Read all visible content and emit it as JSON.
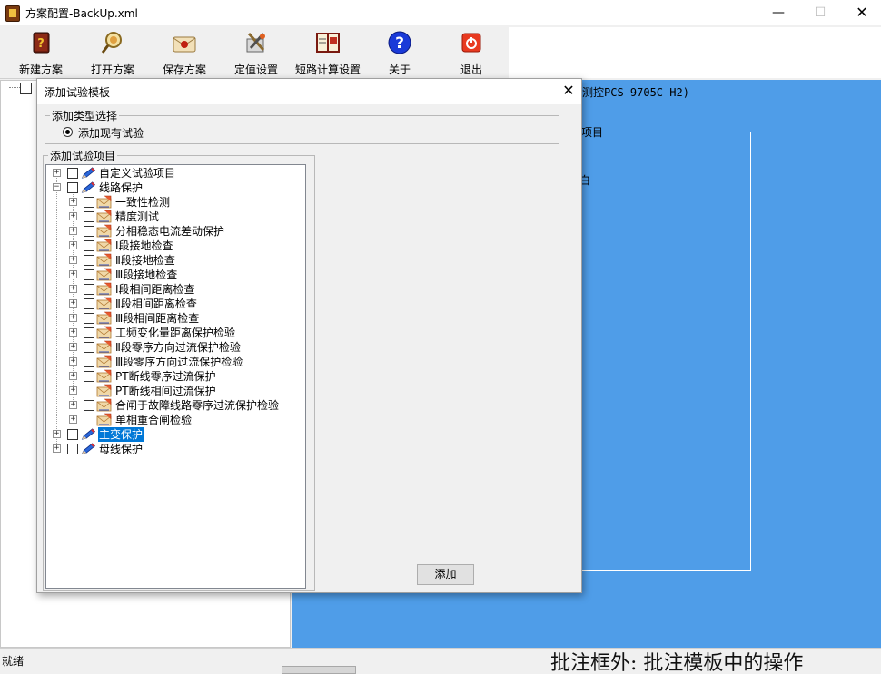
{
  "window": {
    "title": "方案配置-BackUp.xml",
    "min_glyph": "—",
    "max_glyph": "☐",
    "close_glyph": "✕"
  },
  "toolbar": [
    {
      "label": "新建方案",
      "icon": "new-scheme-book-icon"
    },
    {
      "label": "打开方案",
      "icon": "open-scheme-magnifier-icon"
    },
    {
      "label": "保存方案",
      "icon": "save-scheme-envelope-icon"
    },
    {
      "label": "定值设置",
      "icon": "setting-values-tools-icon"
    },
    {
      "label": "短路计算设置",
      "icon": "short-circuit-calc-book-icon"
    },
    {
      "label": "关于",
      "icon": "help-question-icon"
    },
    {
      "label": "退出",
      "icon": "exit-power-icon"
    }
  ],
  "right_panel": {
    "header": "测控PCS-9705C-H2)",
    "group_label": "的项目",
    "fragment": "白"
  },
  "dialog": {
    "title": "添加试验模板",
    "close_glyph": "✕",
    "type_group_label": "添加类型选择",
    "radio_label": "添加现有试验",
    "items_group_label": "添加试验项目",
    "add_button": "添加"
  },
  "tree": [
    {
      "label": "自定义试验项目",
      "level": 0,
      "expander": "+",
      "icon": "pencil-icon",
      "selected": false
    },
    {
      "label": "线路保护",
      "level": 0,
      "expander": "−",
      "icon": "pencil-icon",
      "selected": false
    },
    {
      "label": "一致性检测",
      "level": 1,
      "expander": "+",
      "icon": "test-item-icon",
      "selected": false
    },
    {
      "label": "精度测试",
      "level": 1,
      "expander": "+",
      "icon": "test-item-icon",
      "selected": false
    },
    {
      "label": "分相稳态电流差动保护",
      "level": 1,
      "expander": "+",
      "icon": "test-item-icon",
      "selected": false
    },
    {
      "label": "Ⅰ段接地检查",
      "level": 1,
      "expander": "+",
      "icon": "test-item-icon",
      "selected": false
    },
    {
      "label": "Ⅱ段接地检查",
      "level": 1,
      "expander": "+",
      "icon": "test-item-icon",
      "selected": false
    },
    {
      "label": "Ⅲ段接地检查",
      "level": 1,
      "expander": "+",
      "icon": "test-item-icon",
      "selected": false
    },
    {
      "label": "Ⅰ段相间距离检查",
      "level": 1,
      "expander": "+",
      "icon": "test-item-icon",
      "selected": false
    },
    {
      "label": "Ⅱ段相间距离检查",
      "level": 1,
      "expander": "+",
      "icon": "test-item-icon",
      "selected": false
    },
    {
      "label": "Ⅲ段相间距离检查",
      "level": 1,
      "expander": "+",
      "icon": "test-item-icon",
      "selected": false
    },
    {
      "label": "工频变化量距离保护检验",
      "level": 1,
      "expander": "+",
      "icon": "test-item-icon",
      "selected": false
    },
    {
      "label": "Ⅱ段零序方向过流保护检验",
      "level": 1,
      "expander": "+",
      "icon": "test-item-icon",
      "selected": false
    },
    {
      "label": "Ⅲ段零序方向过流保护检验",
      "level": 1,
      "expander": "+",
      "icon": "test-item-icon",
      "selected": false
    },
    {
      "label": "PT断线零序过流保护",
      "level": 1,
      "expander": "+",
      "icon": "test-item-icon",
      "selected": false
    },
    {
      "label": "PT断线相间过流保护",
      "level": 1,
      "expander": "+",
      "icon": "test-item-icon",
      "selected": false
    },
    {
      "label": "合闸于故障线路零序过流保护检验",
      "level": 1,
      "expander": "+",
      "icon": "test-item-icon",
      "selected": false
    },
    {
      "label": "单相重合闸检验",
      "level": 1,
      "expander": "+",
      "icon": "test-item-icon",
      "selected": false
    },
    {
      "label": "主变保护",
      "level": 0,
      "expander": "+",
      "icon": "pencil-icon",
      "selected": true
    },
    {
      "label": "母线保护",
      "level": 0,
      "expander": "+",
      "icon": "pencil-icon",
      "selected": false
    }
  ],
  "statusbar": {
    "text": "就绪",
    "background_fragment": "批注框外: 批注模板中的操作"
  }
}
